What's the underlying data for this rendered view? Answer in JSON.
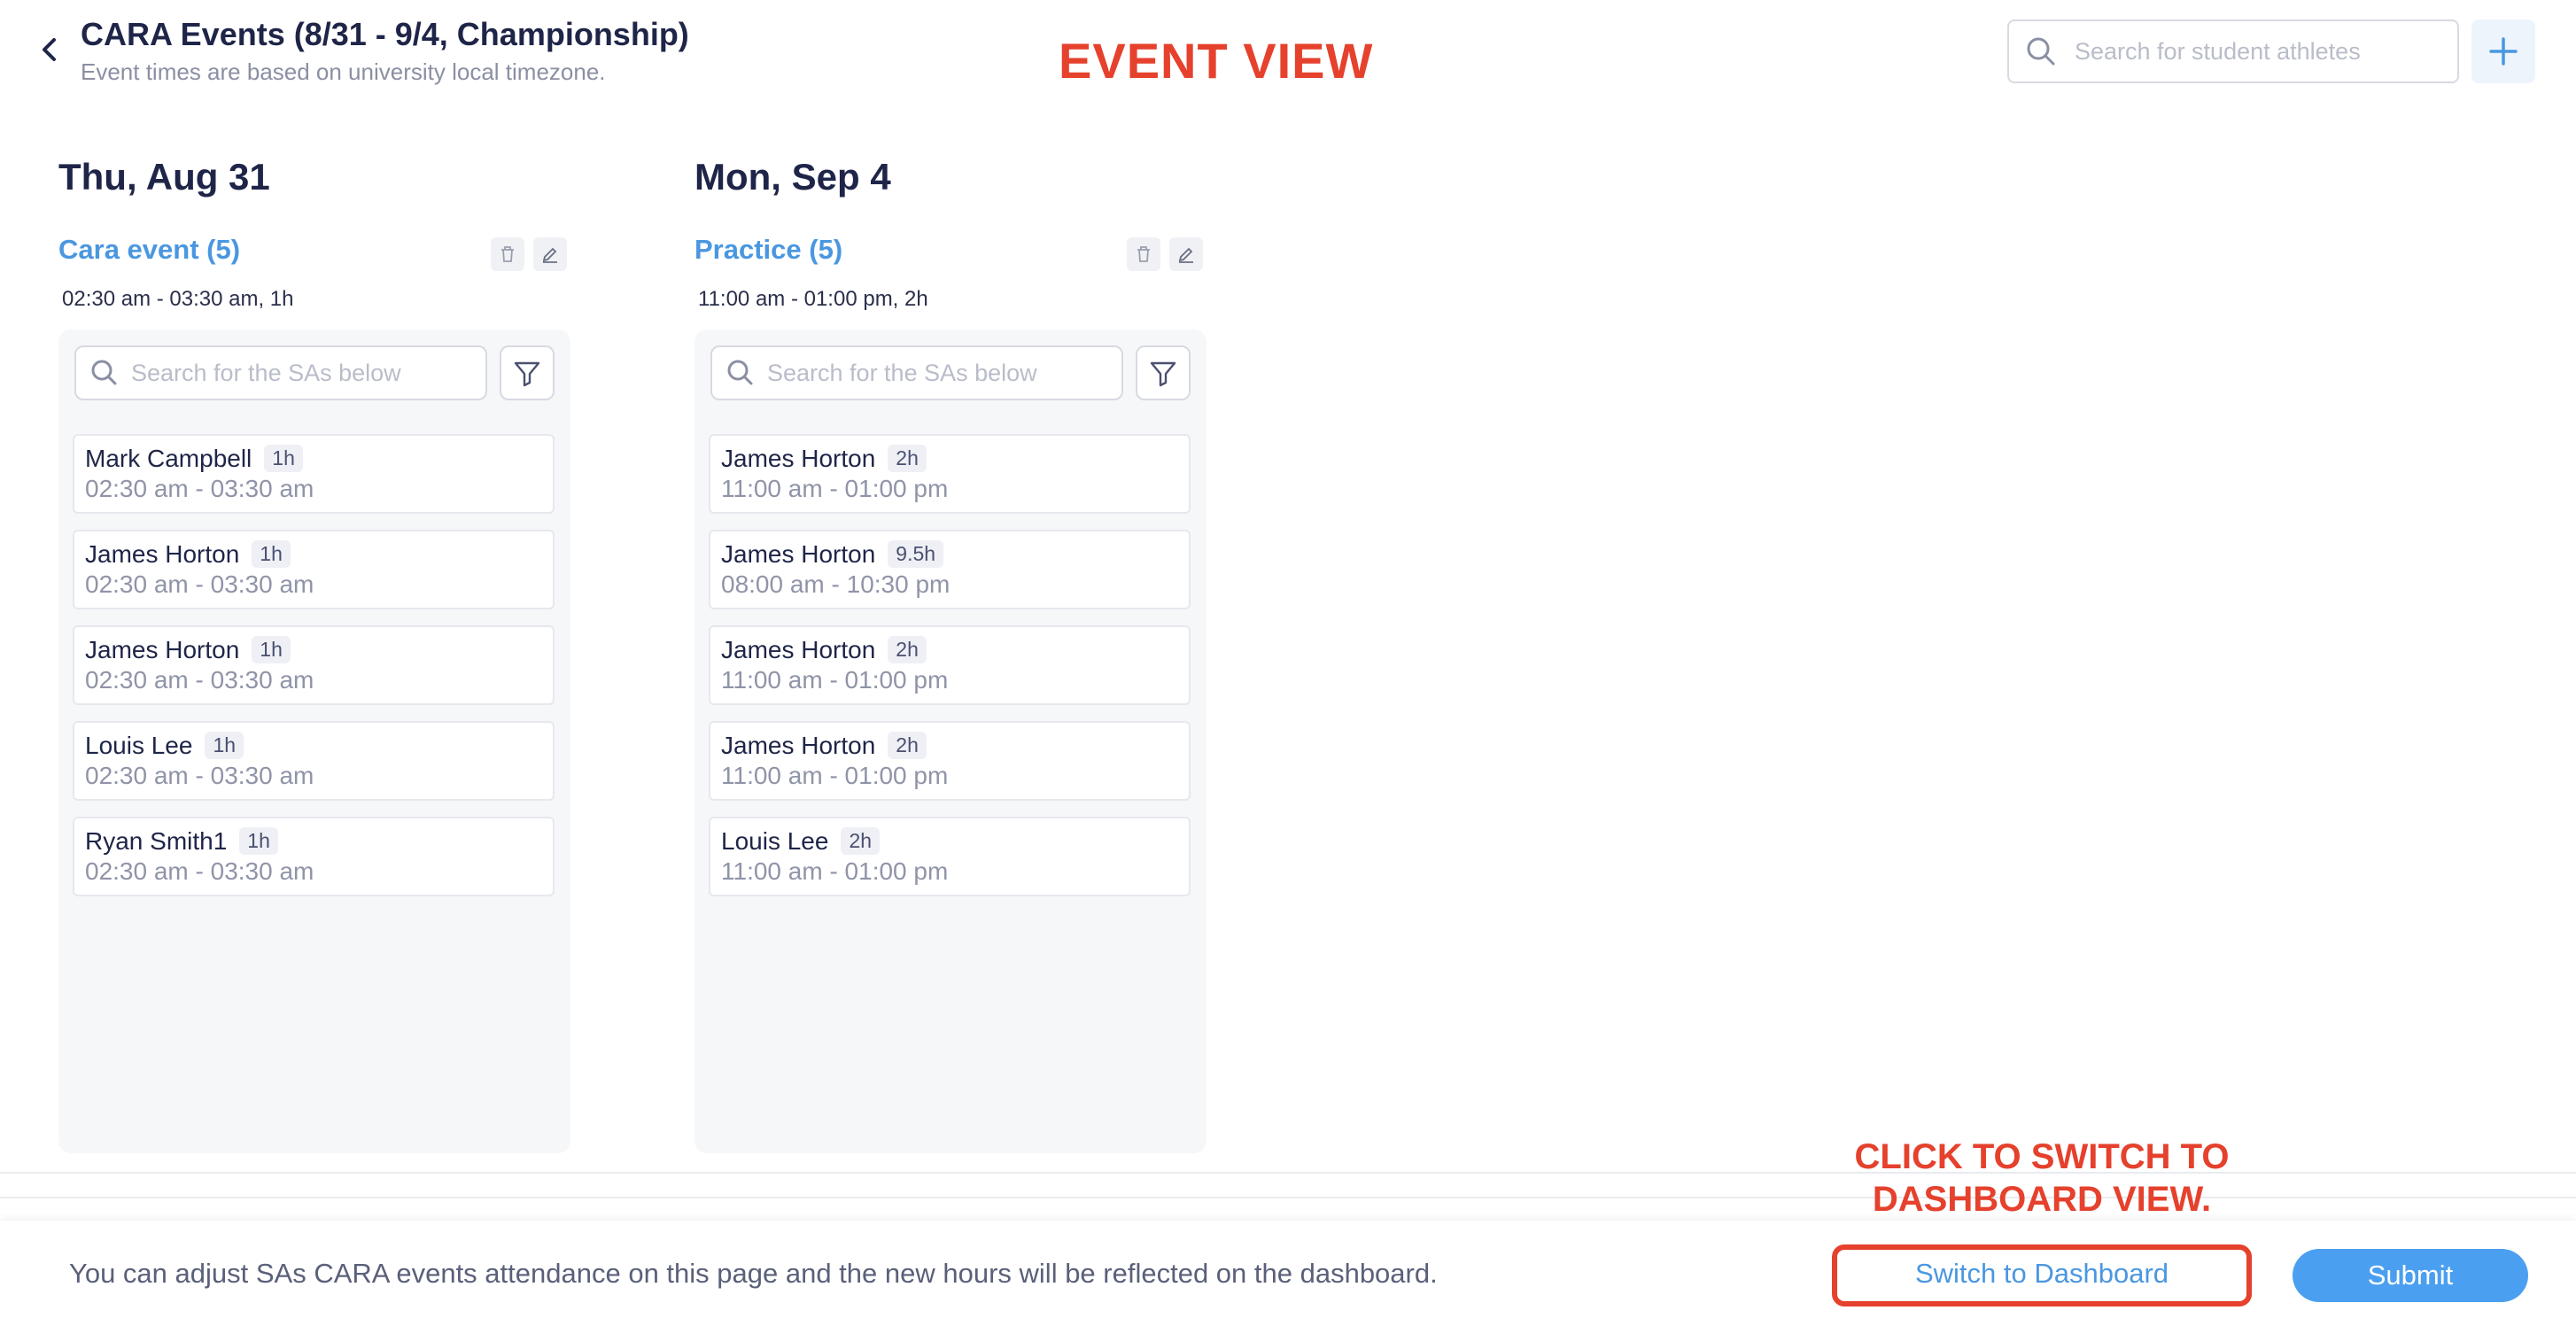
{
  "header": {
    "title": "CARA Events (8/31 - 9/4, Championship)",
    "subtitle": "Event times are based on university local timezone.",
    "back_icon": "chevron-left-icon",
    "search": {
      "placeholder": "Search for student athletes",
      "icon": "search-icon"
    },
    "add_icon": "plus-icon"
  },
  "annotations": {
    "event_view": "EVENT VIEW",
    "click_hint_line1": "CLICK TO SWITCH TO",
    "click_hint_line2": "DASHBOARD VIEW."
  },
  "days": [
    {
      "title": "Thu, Aug 31",
      "event_name": "Cara event (5)",
      "event_time": "02:30 am - 03:30 am, 1h",
      "search_placeholder": "Search for the SAs below",
      "athletes": [
        {
          "name": "Mark Campbell",
          "hours": "1h",
          "time": "02:30 am - 03:30 am"
        },
        {
          "name": "James Horton",
          "hours": "1h",
          "time": "02:30 am - 03:30 am"
        },
        {
          "name": "James Horton",
          "hours": "1h",
          "time": "02:30 am - 03:30 am"
        },
        {
          "name": "Louis Lee",
          "hours": "1h",
          "time": "02:30 am - 03:30 am"
        },
        {
          "name": "Ryan Smith1",
          "hours": "1h",
          "time": "02:30 am - 03:30 am"
        }
      ]
    },
    {
      "title": "Mon, Sep 4",
      "event_name": "Practice (5)",
      "event_time": "11:00 am - 01:00 pm, 2h",
      "search_placeholder": "Search for the SAs below",
      "athletes": [
        {
          "name": "James Horton",
          "hours": "2h",
          "time": "11:00 am - 01:00 pm"
        },
        {
          "name": "James Horton",
          "hours": "9.5h",
          "time": "08:00 am - 10:30 pm"
        },
        {
          "name": "James Horton",
          "hours": "2h",
          "time": "11:00 am - 01:00 pm"
        },
        {
          "name": "James Horton",
          "hours": "2h",
          "time": "11:00 am - 01:00 pm"
        },
        {
          "name": "Louis Lee",
          "hours": "2h",
          "time": "11:00 am - 01:00 pm"
        }
      ]
    }
  ],
  "footer": {
    "message": "You can adjust SAs CARA events attendance on this page and the new hours will be reflected on the dashboard.",
    "switch_label": "Switch to Dashboard",
    "submit_label": "Submit"
  },
  "colors": {
    "accent": "#4a97e0",
    "annotation": "#e5412d",
    "submit": "#4a9ff0",
    "text_dark": "#1f2548",
    "text_muted": "#8f94a8"
  }
}
